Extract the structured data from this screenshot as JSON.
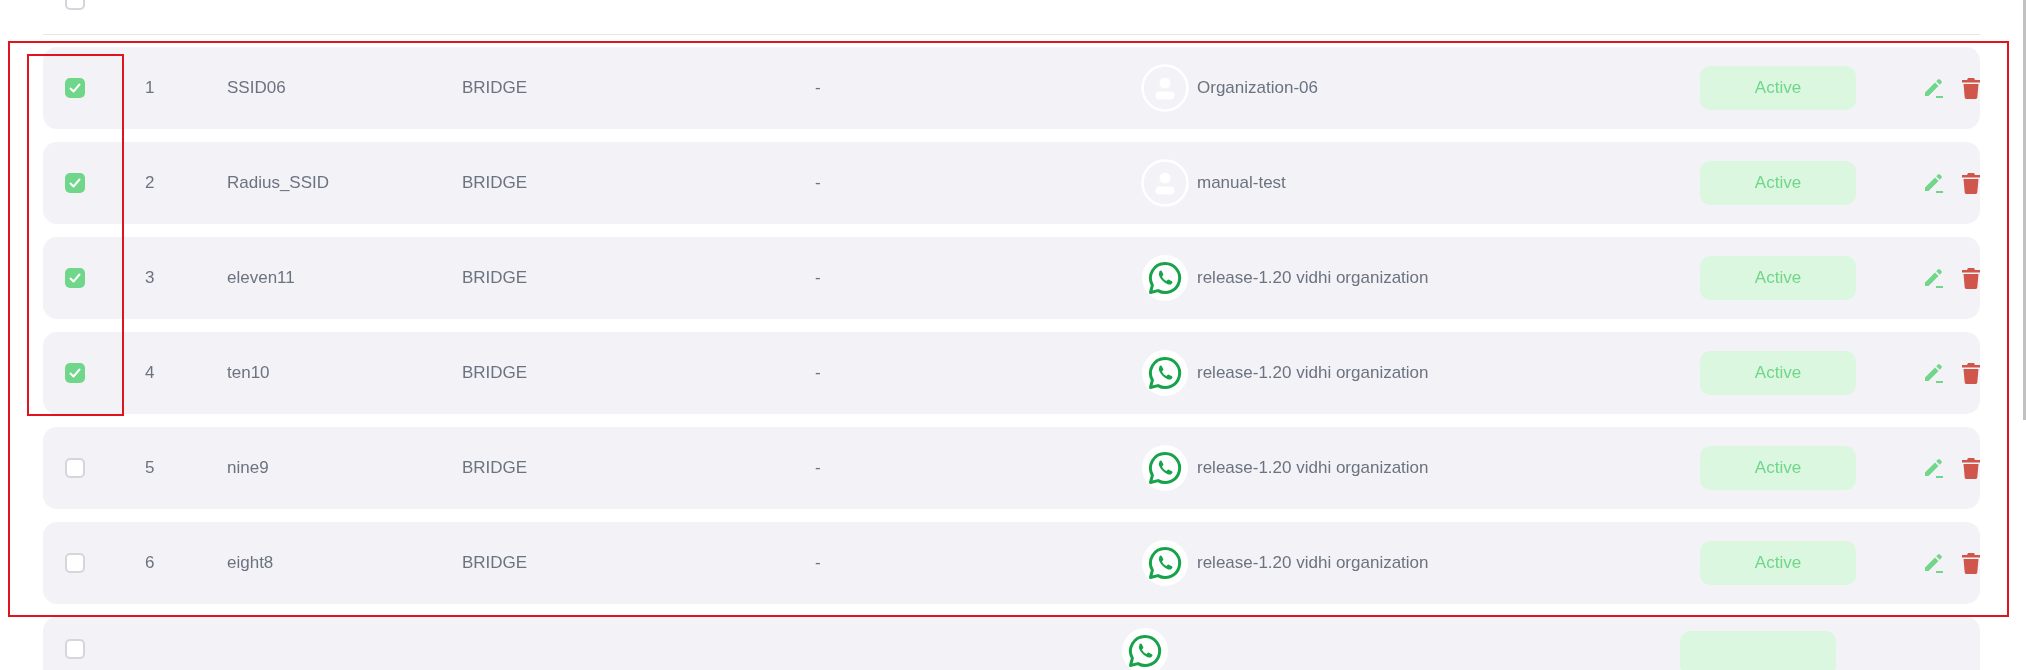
{
  "header": {
    "checked": false
  },
  "partial_row": {
    "checked": false
  },
  "rows": [
    {
      "checked": true,
      "number": "1",
      "name": "SSID06",
      "mode": "BRIDGE",
      "column_4": "-",
      "avatar": {
        "kind": "person"
      },
      "organization": "Organization-06",
      "status": "Active"
    },
    {
      "checked": true,
      "number": "2",
      "name": "Radius_SSID",
      "mode": "BRIDGE",
      "column_4": "-",
      "avatar": {
        "kind": "person"
      },
      "organization": "manual-test",
      "status": "Active"
    },
    {
      "checked": true,
      "number": "3",
      "name": "eleven11",
      "mode": "BRIDGE",
      "column_4": "-",
      "avatar": {
        "kind": "whatsapp"
      },
      "organization": "release-1.20 vidhi organization",
      "status": "Active"
    },
    {
      "checked": true,
      "number": "4",
      "name": "ten10",
      "mode": "BRIDGE",
      "column_4": "-",
      "avatar": {
        "kind": "whatsapp"
      },
      "organization": "release-1.20 vidhi organization",
      "status": "Active"
    },
    {
      "checked": false,
      "number": "5",
      "name": "nine9",
      "mode": "BRIDGE",
      "column_4": "-",
      "avatar": {
        "kind": "whatsapp"
      },
      "organization": "release-1.20 vidhi organization",
      "status": "Active"
    },
    {
      "checked": false,
      "number": "6",
      "name": "eight8",
      "mode": "BRIDGE",
      "column_4": "-",
      "avatar": {
        "kind": "whatsapp"
      },
      "organization": "release-1.20 vidhi organization",
      "status": "Active"
    }
  ]
}
